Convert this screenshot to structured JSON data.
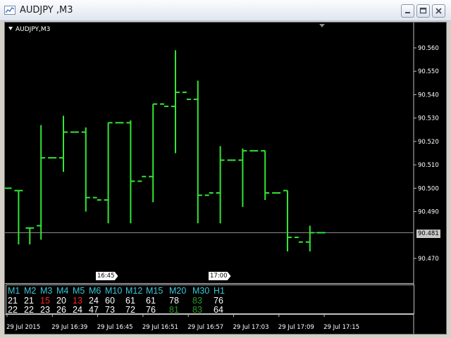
{
  "window": {
    "title": "AUDJPY ,M3"
  },
  "chart": {
    "symbol_label": "AUDJPY,M3",
    "current_price": "90.481"
  },
  "chart_data": {
    "type": "ohlc",
    "symbol": "AUDJPY",
    "timeframe": "M3",
    "y_ticks": [
      "90.560",
      "90.550",
      "90.540",
      "90.530",
      "90.520",
      "90.510",
      "90.500",
      "90.490",
      "90.470"
    ],
    "ylim": [
      90.46,
      90.566
    ],
    "current_price": 90.481,
    "x_labels": [
      "29 Jul 2015",
      "29 Jul 16:39",
      "29 Jul 16:45",
      "29 Jul 16:51",
      "29 Jul 16:57",
      "29 Jul 17:03",
      "29 Jul 17:09",
      "29 Jul 17:15"
    ],
    "time_boxes": [
      "16:45",
      "17:00"
    ],
    "bars": [
      {
        "o": 90.5,
        "h": 90.5,
        "l": 90.5,
        "c": 90.5
      },
      {
        "o": 90.499,
        "h": 90.499,
        "l": 90.476,
        "c": 90.499
      },
      {
        "o": 90.483,
        "h": 90.483,
        "l": 90.476,
        "c": 90.483
      },
      {
        "o": 90.484,
        "h": 90.527,
        "l": 90.478,
        "c": 90.513
      },
      {
        "o": 90.513,
        "h": 90.513,
        "l": 90.513,
        "c": 90.513
      },
      {
        "o": 90.513,
        "h": 90.531,
        "l": 90.507,
        "c": 90.524
      },
      {
        "o": 90.524,
        "h": 90.524,
        "l": 90.524,
        "c": 90.524
      },
      {
        "o": 90.524,
        "h": 90.526,
        "l": 90.49,
        "c": 90.496
      },
      {
        "o": 90.496,
        "h": 90.496,
        "l": 90.496,
        "c": 90.495
      },
      {
        "o": 90.495,
        "h": 90.528,
        "l": 90.485,
        "c": 90.528
      },
      {
        "o": 90.528,
        "h": 90.528,
        "l": 90.528,
        "c": 90.528
      },
      {
        "o": 90.528,
        "h": 90.529,
        "l": 90.485,
        "c": 90.503
      },
      {
        "o": 90.503,
        "h": 90.505,
        "l": 90.505,
        "c": 90.505
      },
      {
        "o": 90.505,
        "h": 90.536,
        "l": 90.494,
        "c": 90.536
      },
      {
        "o": 90.536,
        "h": 90.536,
        "l": 90.536,
        "c": 90.535
      },
      {
        "o": 90.535,
        "h": 90.559,
        "l": 90.515,
        "c": 90.541
      },
      {
        "o": 90.541,
        "h": 90.541,
        "l": 90.541,
        "c": 90.538
      },
      {
        "o": 90.538,
        "h": 90.546,
        "l": 90.485,
        "c": 90.497
      },
      {
        "o": 90.497,
        "h": 90.497,
        "l": 90.497,
        "c": 90.498
      },
      {
        "o": 90.498,
        "h": 90.518,
        "l": 90.485,
        "c": 90.512
      },
      {
        "o": 90.512,
        "h": 90.512,
        "l": 90.512,
        "c": 90.512
      },
      {
        "o": 90.512,
        "h": 90.517,
        "l": 90.492,
        "c": 90.516
      },
      {
        "o": 90.516,
        "h": 90.516,
        "l": 90.516,
        "c": 90.516
      },
      {
        "o": 90.516,
        "h": 90.516,
        "l": 90.495,
        "c": 90.498
      },
      {
        "o": 90.498,
        "h": 90.498,
        "l": 90.498,
        "c": 90.498
      },
      {
        "o": 90.499,
        "h": 90.499,
        "l": 90.473,
        "c": 90.479
      },
      {
        "o": 90.479,
        "h": 90.479,
        "l": 90.479,
        "c": 90.477
      },
      {
        "o": 90.477,
        "h": 90.484,
        "l": 90.473,
        "c": 90.481
      },
      {
        "o": 90.481,
        "h": 90.481,
        "l": 90.481,
        "c": 90.481
      }
    ]
  },
  "timeframe_panel": {
    "headers": [
      "M1",
      "M2",
      "M3",
      "M4",
      "M5",
      "M6",
      "M10",
      "M12",
      "M15",
      "M20",
      "M30",
      "H1"
    ],
    "row1": [
      {
        "v": "21",
        "c": "white"
      },
      {
        "v": "21",
        "c": "white"
      },
      {
        "v": "15",
        "c": "red"
      },
      {
        "v": "20",
        "c": "white"
      },
      {
        "v": "13",
        "c": "red"
      },
      {
        "v": "24",
        "c": "white"
      },
      {
        "v": "60",
        "c": "white"
      },
      {
        "v": "61",
        "c": "white"
      },
      {
        "v": "61",
        "c": "white"
      },
      {
        "v": "78",
        "c": "white"
      },
      {
        "v": "83",
        "c": "darkgreen"
      },
      {
        "v": "76",
        "c": "white"
      }
    ],
    "row2": [
      {
        "v": "22",
        "c": "white"
      },
      {
        "v": "22",
        "c": "white"
      },
      {
        "v": "23",
        "c": "white"
      },
      {
        "v": "26",
        "c": "white"
      },
      {
        "v": "24",
        "c": "white"
      },
      {
        "v": "47",
        "c": "white"
      },
      {
        "v": "73",
        "c": "white"
      },
      {
        "v": "72",
        "c": "white"
      },
      {
        "v": "76",
        "c": "white"
      },
      {
        "v": "81",
        "c": "darkgreen"
      },
      {
        "v": "83",
        "c": "darkgreen"
      },
      {
        "v": "64",
        "c": "white"
      }
    ]
  },
  "colors": {
    "bar": "#33e633",
    "background": "#000000",
    "axis_text": "#ffffff",
    "header": "#38c8d8",
    "red": "#ff2020",
    "darkgreen": "#2a9a2a"
  }
}
